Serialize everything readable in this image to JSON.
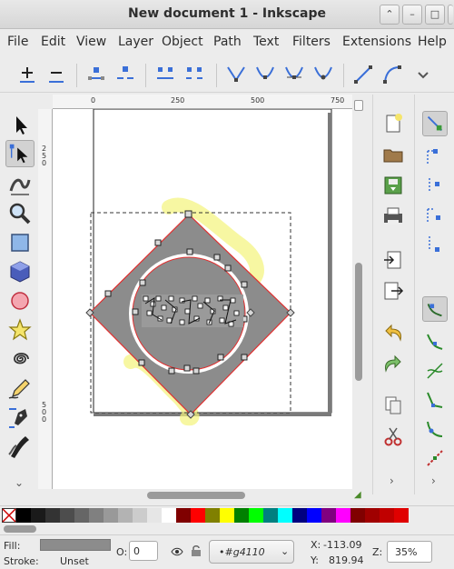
{
  "window": {
    "title": "New document 1 - Inkscape",
    "buttons": [
      "chevron-up",
      "minimize",
      "maximize",
      "close"
    ]
  },
  "menu": [
    "File",
    "Edit",
    "View",
    "Layer",
    "Object",
    "Path",
    "Text",
    "Filters",
    "Extensions",
    "Help"
  ],
  "node_toolbar": {
    "buttons": [
      "insert-node",
      "delete-node",
      "join-nodes",
      "break-path",
      "join-endnodes-segment",
      "delete-segment",
      "make-cusp",
      "make-smooth",
      "make-symmetric",
      "make-auto-smooth",
      "make-line",
      "make-curve"
    ],
    "overflow": "chevron-down-icon"
  },
  "tools": [
    "selector",
    "node",
    "tweak",
    "zoom",
    "rectangle",
    "3d-box",
    "ellipse",
    "star",
    "spiral",
    "pencil",
    "pen",
    "calligraphy"
  ],
  "active_tool": "node",
  "ruler": {
    "top_labels": [
      "0",
      "250",
      "500",
      "750"
    ],
    "left_labels": [
      "2\n5\n0",
      "5\n0\n0"
    ]
  },
  "commands": [
    "new",
    "open",
    "save",
    "print",
    "import",
    "export",
    "undo",
    "redo",
    "copy",
    "cut"
  ],
  "snap": [
    "snap-enable",
    "snap-bbox",
    "snap-bbox-edge",
    "snap-bbox-corner",
    "snap-bbox-midpoint",
    "snap-nodes",
    "snap-path",
    "snap-path-intersection",
    "snap-cusp",
    "snap-smooth",
    "snap-midpoint",
    "snap-center"
  ],
  "palette": {
    "colors": [
      "#000000",
      "#1a1a1a",
      "#333333",
      "#4d4d4d",
      "#666666",
      "#808080",
      "#999999",
      "#b3b3b3",
      "#cccccc",
      "#e6e6e6",
      "#ffffff",
      "#800000",
      "#ff0000",
      "#808000",
      "#ffff00",
      "#008000",
      "#00ff00",
      "#008080",
      "#00ffff",
      "#000080",
      "#0000ff",
      "#800080",
      "#ff00ff",
      "#800000",
      "#a00000",
      "#c00000",
      "#e00000"
    ]
  },
  "status": {
    "fill_label": "Fill:",
    "fill_color": "#8c8c8c",
    "stroke_label": "Stroke:",
    "stroke_value": "Unset",
    "opacity_label": "O:",
    "opacity_value": "0",
    "layer_value": "•#g4110",
    "x_label": "X:",
    "x_value": "-113.09",
    "y_label": "Y:",
    "y_value": "819.94",
    "zoom_label": "Z:",
    "zoom_value": "35%"
  }
}
